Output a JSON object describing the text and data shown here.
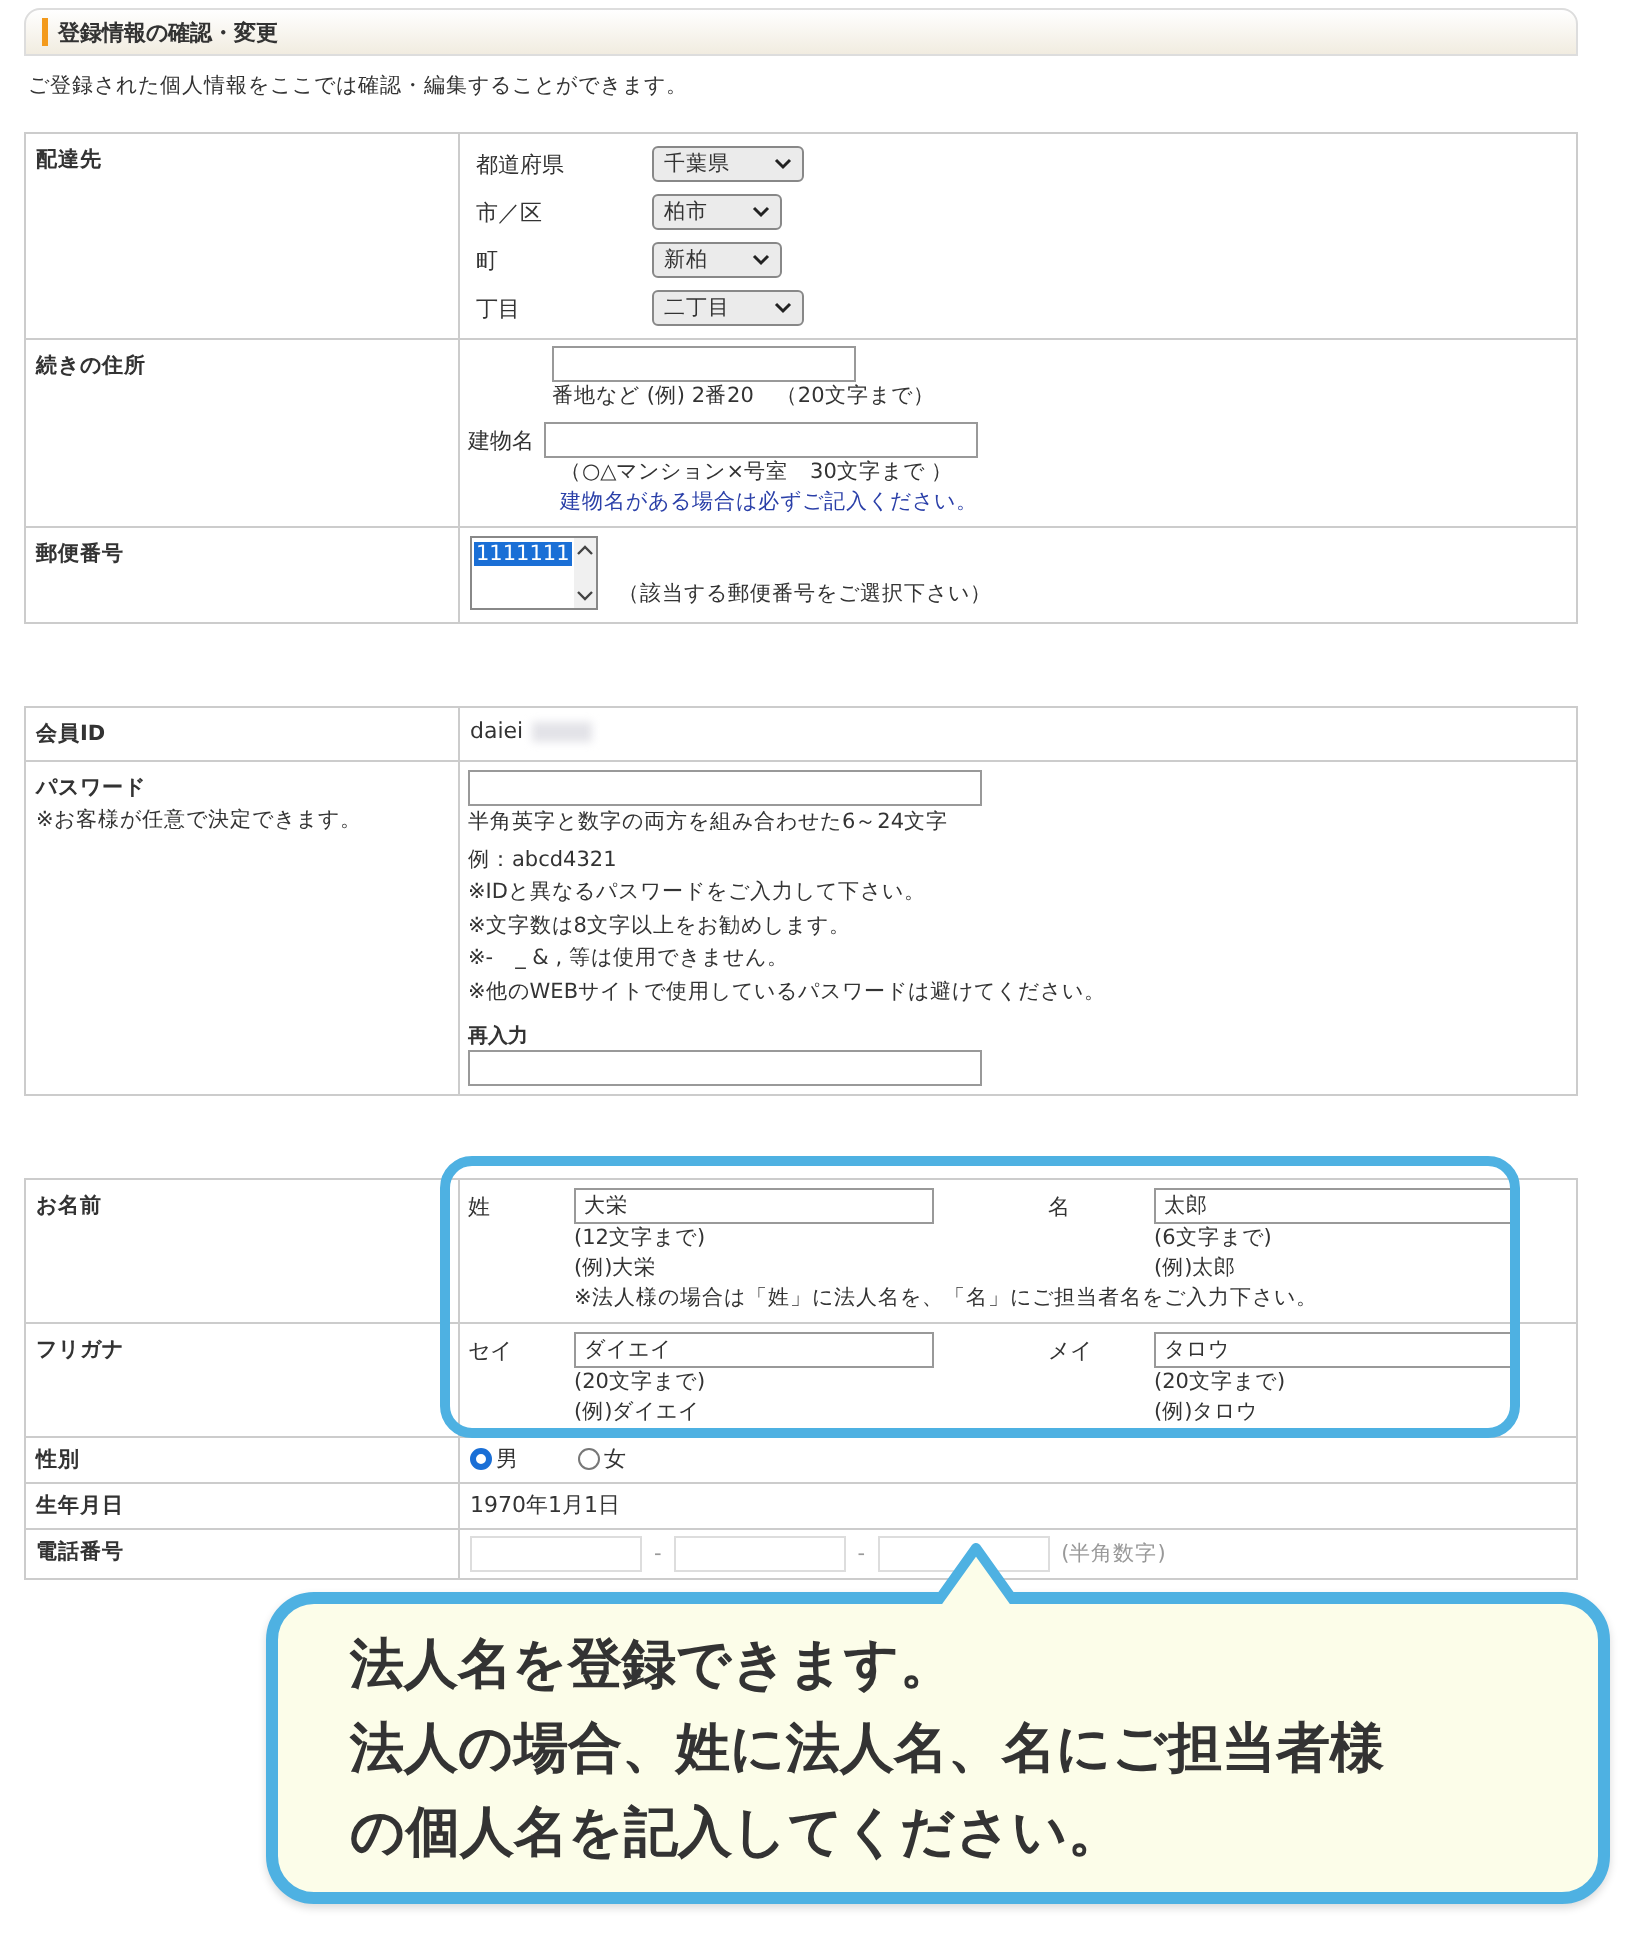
{
  "header": {
    "title": "登録情報の確認・変更"
  },
  "intro": "ご登録された個人情報をここでは確認・編集することができます。",
  "delivery": {
    "label": "配達先",
    "selects": [
      {
        "label": "都道府県",
        "value": "千葉県"
      },
      {
        "label": "市／区",
        "value": "柏市"
      },
      {
        "label": "町",
        "value": "新柏"
      },
      {
        "label": "丁目",
        "value": "二丁目"
      }
    ]
  },
  "address": {
    "label": "続きの住所",
    "hint": "番地など (例) 2番20　（20文字まで）",
    "building_label": "建物名",
    "building_hint": "（○△マンション×号室　30文字まで ）",
    "building_note": "建物名がある場合は必ずご記入ください。"
  },
  "postal": {
    "label": "郵便番号",
    "options": [
      {
        "value": "1111111",
        "selected": true
      }
    ],
    "hint": "（該当する郵便番号をご選択下さい）"
  },
  "member_id": {
    "label": "会員ID",
    "value": "daiei"
  },
  "password": {
    "label": "パスワード",
    "note": "※お客様が任意で決定できます。",
    "rules": [
      "半角英字と数字の両方を組み合わせた6～24文字",
      "例：abcd4321",
      "※IDと異なるパスワードをご入力して下さい。",
      "※文字数は8文字以上をお勧めします。",
      "※-　_ & , 等は使用できません。",
      "※他のWEBサイトで使用しているパスワードは避けてください。"
    ],
    "reenter_label": "再入力"
  },
  "name": {
    "label": "お名前",
    "fields": [
      {
        "label": "姓",
        "value": "大栄",
        "limit": "(12文字まで)",
        "example": "(例)大栄"
      },
      {
        "label": "名",
        "value": "太郎",
        "limit": "(6文字まで)",
        "example": "(例)太郎"
      }
    ],
    "note": "※法人様の場合は「姓」に法人名を、「名」にご担当者名をご入力下さい。"
  },
  "furigana": {
    "label": "フリガナ",
    "fields": [
      {
        "label": "セイ",
        "value": "ダイエイ",
        "limit": "(20文字まで)",
        "example": "(例)ダイエイ"
      },
      {
        "label": "メイ",
        "value": "タロウ",
        "limit": "(20文字まで)",
        "example": "(例)タロウ"
      }
    ]
  },
  "gender": {
    "label": "性別",
    "options": [
      {
        "label": "男",
        "selected": true
      },
      {
        "label": "女",
        "selected": false
      }
    ]
  },
  "birthday": {
    "label": "生年月日",
    "value": "1970年1月1日"
  },
  "phone": {
    "label": "電話番号",
    "separators": [
      "-",
      "-"
    ],
    "hint": "(半角数字)"
  },
  "callout": {
    "lines": [
      "法人名を登録できます。",
      "法人の場合、姓に法人名、名にご担当者様",
      "の個人名を記入してください。"
    ]
  }
}
